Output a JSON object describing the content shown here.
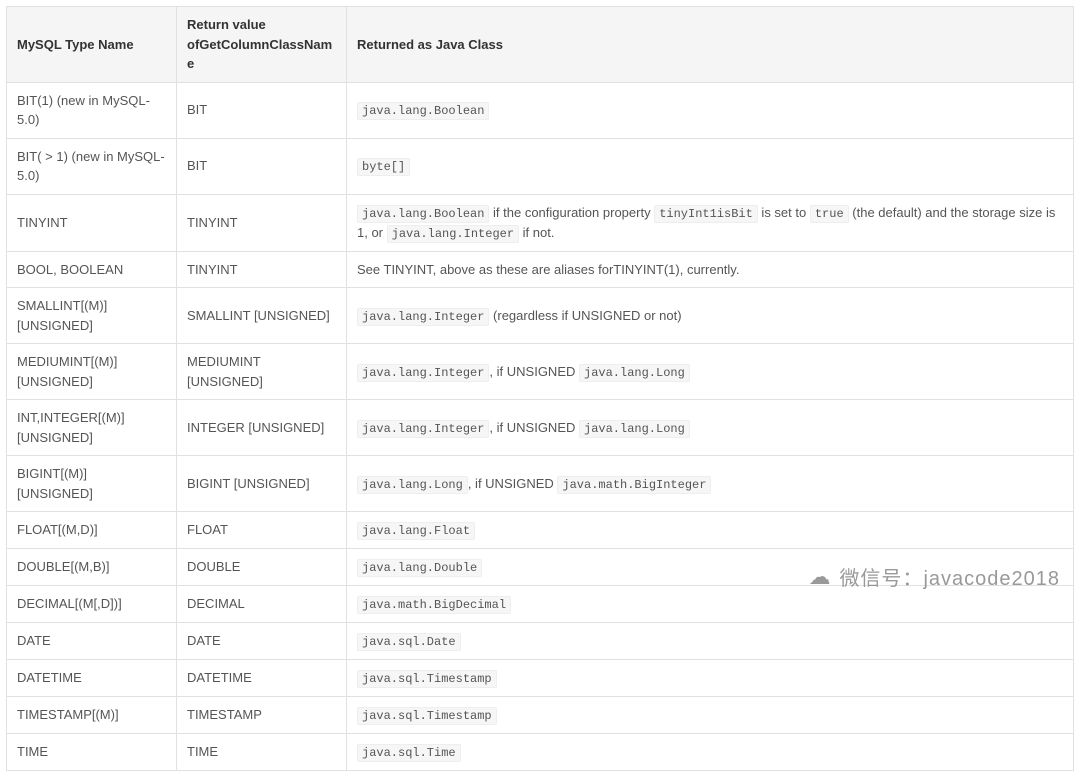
{
  "table": {
    "headers": [
      "MySQL Type Name",
      "Return value ofGetColumnClassName",
      "Returned as Java Class"
    ],
    "rows": [
      {
        "c1": "BIT(1) (new in MySQL-5.0)",
        "c2": "BIT",
        "c3": [
          {
            "t": "code",
            "v": "java.lang.Boolean"
          }
        ]
      },
      {
        "c1": "BIT( > 1) (new in MySQL-5.0)",
        "c2": "BIT",
        "c3": [
          {
            "t": "code",
            "v": "byte[]"
          }
        ]
      },
      {
        "c1": "TINYINT",
        "c2": "TINYINT",
        "c3": [
          {
            "t": "code",
            "v": "java.lang.Boolean"
          },
          {
            "t": "text",
            "v": " if the configuration property "
          },
          {
            "t": "code",
            "v": "tinyInt1isBit"
          },
          {
            "t": "text",
            "v": " is set to "
          },
          {
            "t": "code",
            "v": "true"
          },
          {
            "t": "text",
            "v": " (the default) and the storage size is 1, or "
          },
          {
            "t": "code",
            "v": "java.lang.Integer"
          },
          {
            "t": "text",
            "v": " if not."
          }
        ]
      },
      {
        "c1": "BOOL, BOOLEAN",
        "c2": "TINYINT",
        "c3": [
          {
            "t": "text",
            "v": "See TINYINT, above as these are aliases forTINYINT(1), currently."
          }
        ]
      },
      {
        "c1": "SMALLINT[(M)] [UNSIGNED]",
        "c2": "SMALLINT [UNSIGNED]",
        "c3": [
          {
            "t": "code",
            "v": "java.lang.Integer"
          },
          {
            "t": "text",
            "v": " (regardless if UNSIGNED or not)"
          }
        ]
      },
      {
        "c1": "MEDIUMINT[(M)] [UNSIGNED]",
        "c2": "MEDIUMINT [UNSIGNED]",
        "c3": [
          {
            "t": "code",
            "v": "java.lang.Integer"
          },
          {
            "t": "text",
            "v": ", if UNSIGNED "
          },
          {
            "t": "code",
            "v": "java.lang.Long"
          }
        ]
      },
      {
        "c1": "INT,INTEGER[(M)] [UNSIGNED]",
        "c2": "INTEGER [UNSIGNED]",
        "c3": [
          {
            "t": "code",
            "v": "java.lang.Integer"
          },
          {
            "t": "text",
            "v": ", if UNSIGNED "
          },
          {
            "t": "code",
            "v": "java.lang.Long"
          }
        ]
      },
      {
        "c1": "BIGINT[(M)] [UNSIGNED]",
        "c2": "BIGINT [UNSIGNED]",
        "c3": [
          {
            "t": "code",
            "v": "java.lang.Long"
          },
          {
            "t": "text",
            "v": ", if UNSIGNED "
          },
          {
            "t": "code",
            "v": "java.math.BigInteger"
          }
        ]
      },
      {
        "c1": "FLOAT[(M,D)]",
        "c2": "FLOAT",
        "c3": [
          {
            "t": "code",
            "v": "java.lang.Float"
          }
        ]
      },
      {
        "c1": "DOUBLE[(M,B)]",
        "c2": "DOUBLE",
        "c3": [
          {
            "t": "code",
            "v": "java.lang.Double"
          }
        ]
      },
      {
        "c1": "DECIMAL[(M[,D])]",
        "c2": "DECIMAL",
        "c3": [
          {
            "t": "code",
            "v": "java.math.BigDecimal"
          }
        ]
      },
      {
        "c1": "DATE",
        "c2": "DATE",
        "c3": [
          {
            "t": "code",
            "v": "java.sql.Date"
          }
        ]
      },
      {
        "c1": "DATETIME",
        "c2": "DATETIME",
        "c3": [
          {
            "t": "code",
            "v": "java.sql.Timestamp"
          }
        ]
      },
      {
        "c1": "TIMESTAMP[(M)]",
        "c2": "TIMESTAMP",
        "c3": [
          {
            "t": "code",
            "v": "java.sql.Timestamp"
          }
        ]
      },
      {
        "c1": "TIME",
        "c2": "TIME",
        "c3": [
          {
            "t": "code",
            "v": "java.sql.Time"
          }
        ]
      }
    ]
  },
  "watermark": {
    "label": "微信号：",
    "value": "javacode2018"
  }
}
